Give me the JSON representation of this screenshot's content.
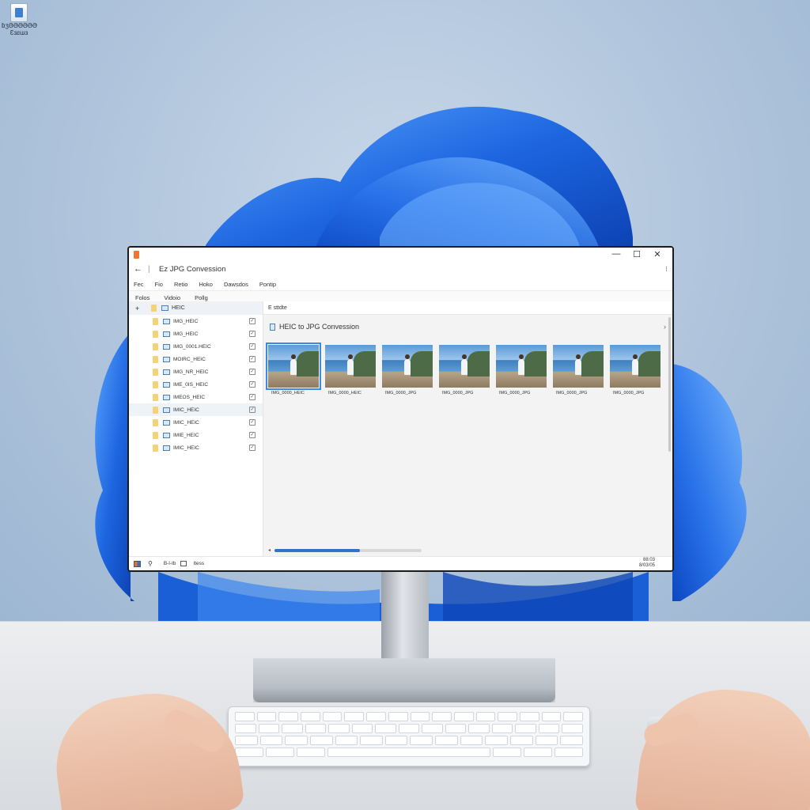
{
  "desktop": {
    "icon_label_line1": "ɓʒƏƏƏƏƏƏ",
    "icon_label_line2": "Ɛɜɛɯɜ"
  },
  "window": {
    "title": "Ez JPG Convession",
    "controls": {
      "minimize": "—",
      "maximize": "☐",
      "close": "✕"
    },
    "title_menu_icon": "⁝",
    "menu": [
      "Fec",
      "Fio",
      "Retio",
      "Hoko",
      "Dawsdos",
      "Pontip"
    ],
    "tabs": [
      "Folos",
      "Vidoio",
      "Pollg"
    ],
    "tree": {
      "root_label": "HEIC",
      "items": [
        {
          "label": "IMG_HEIC",
          "checked": "✓"
        },
        {
          "label": "IMG_HEIC",
          "checked": "✓"
        },
        {
          "label": "IMG_0001.HEIC",
          "checked": "✓"
        },
        {
          "label": "MOIRC_HEIC",
          "checked": "✓"
        },
        {
          "label": "IMG_NR_HEIC",
          "checked": "✓"
        },
        {
          "label": "IME_0IS_HEIC",
          "checked": "✓"
        },
        {
          "label": "IMEOS_HEIC",
          "checked": "✓"
        },
        {
          "label": "IMIC_HEIC",
          "checked": "✓"
        },
        {
          "label": "IMIC_HEIC",
          "checked": "✓"
        },
        {
          "label": "IMIE_HEIC",
          "checked": "✓"
        },
        {
          "label": "IMIC_HEIC",
          "checked": "✓"
        }
      ]
    },
    "breadcrumb": "E sttdte",
    "section_title": "HEIC to JPG Convession",
    "thumbnails": [
      {
        "caption": "IMG_0000_HEIC"
      },
      {
        "caption": "IMG_0000_HEIC"
      },
      {
        "caption": "IMG_0000_JPG"
      },
      {
        "caption": "IMG_0000_JPG"
      },
      {
        "caption": "IMG_0000_JPG"
      },
      {
        "caption": "IMG_0000_JPG"
      },
      {
        "caption": "IMG_0000_JPG"
      }
    ],
    "progress": 0.58,
    "status": {
      "text": "B-l-Ib",
      "label": "Itess",
      "right_line1": "88:03",
      "right_line2": "8/03/05"
    }
  },
  "colors": {
    "accent": "#2f74c9",
    "selection": "#3d8ae0",
    "folder": "#f4d27a",
    "wallpaper_bloom": "#1d66e0"
  }
}
